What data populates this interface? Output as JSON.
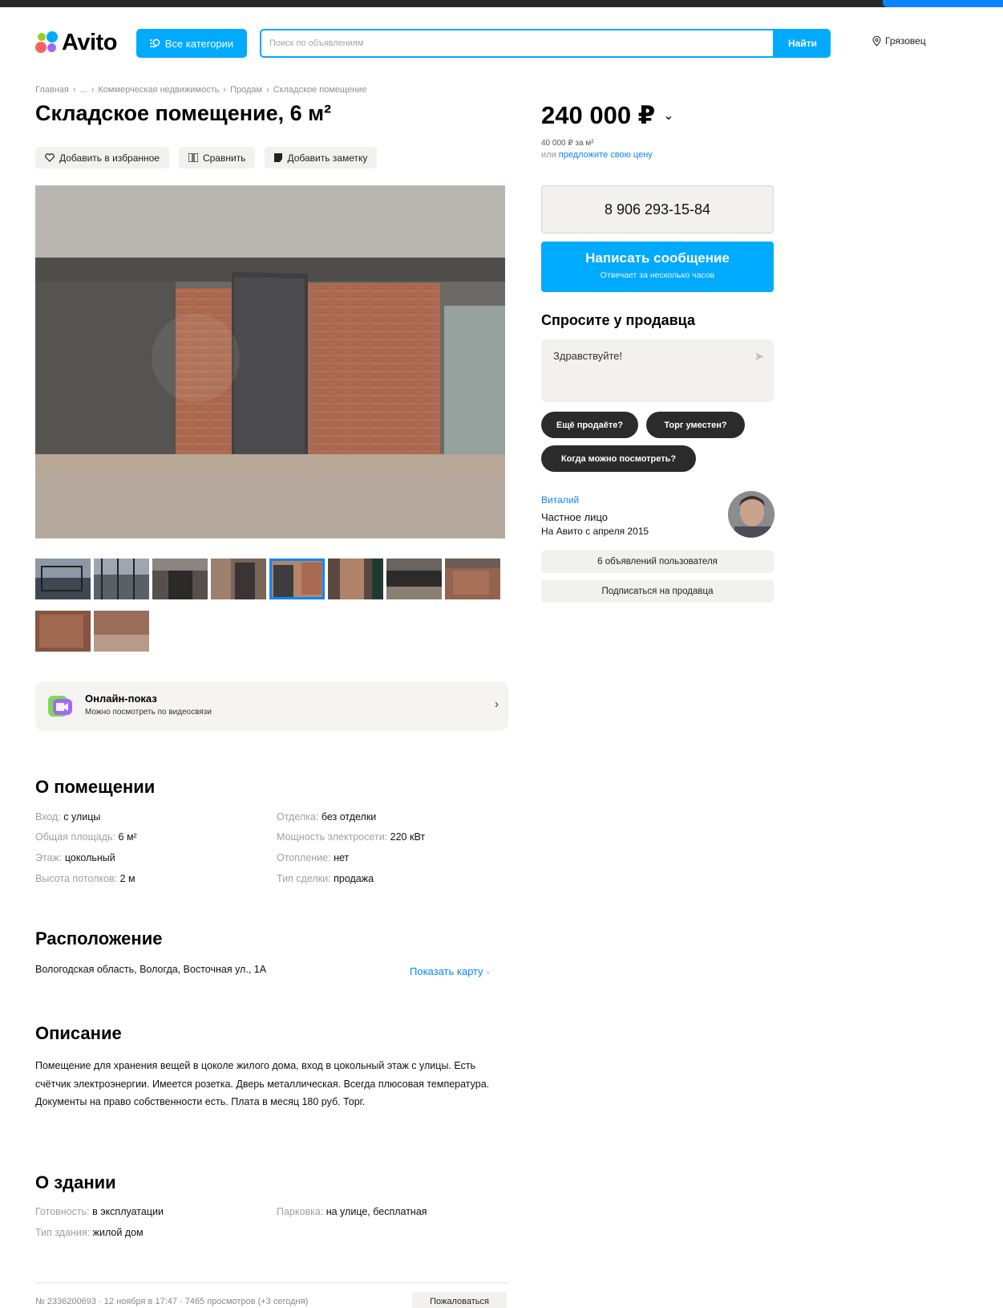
{
  "header": {
    "logo_text": "Avito",
    "categories_label": "Все категории",
    "search_placeholder": "Поиск по объявлениям",
    "search_button": "Найти",
    "location": "Грязовец"
  },
  "breadcrumb": [
    "Главная",
    "...",
    "Коммерческая недвижимость",
    "Продам",
    "Складское помещение"
  ],
  "title": "Складское помещение, 6 м²",
  "actions": {
    "favorite": "Добавить в избранное",
    "compare": "Сравнить",
    "note": "Добавить заметку"
  },
  "gallery": {
    "thumbnails_count": 10,
    "active_index": 4
  },
  "online_show": {
    "title": "Онлайн-показ",
    "subtitle": "Можно посмотреть по видеосвязи"
  },
  "about": {
    "heading": "О помещении",
    "left": [
      {
        "key": "Вход: ",
        "value": "с улицы"
      },
      {
        "key": "Общая площадь: ",
        "value": "6 м²"
      },
      {
        "key": "Этаж: ",
        "value": "цокольный"
      },
      {
        "key": "Высота потолков: ",
        "value": "2 м"
      }
    ],
    "right": [
      {
        "key": "Отделка: ",
        "value": "без отделки"
      },
      {
        "key": "Мощность электросети: ",
        "value": "220 кВт"
      },
      {
        "key": "Отопление: ",
        "value": "нет"
      },
      {
        "key": "Тип сделки: ",
        "value": "продажа"
      }
    ]
  },
  "location_section": {
    "heading": "Расположение",
    "address": "Вологодская область, Вологда, Восточная ул., 1А",
    "show_map": "Показать карту"
  },
  "description": {
    "heading": "Описание",
    "text": "Помещение для хранения вещей в цоколе жилого дома, вход в цокольный этаж с улицы. Есть счётчик электроэнергии. Имеется розетка. Дверь металлическая. Всегда плюсовая температура. Документы на право собственности есть. Плата в месяц 180 руб. Торг."
  },
  "building": {
    "heading": "О здании",
    "left": [
      {
        "key": "Готовность: ",
        "value": "в эксплуатации"
      },
      {
        "key": "Тип здания: ",
        "value": "жилой дом"
      }
    ],
    "right": [
      {
        "key": "Парковка: ",
        "value": "на улице, бесплатная"
      }
    ]
  },
  "footer": {
    "meta": "№ 2336200693 · 12 ноября в 17:47 · 7465 просмотров (+3 сегодня)",
    "report": "Пожаловаться"
  },
  "pricing": {
    "price": "240 000 ₽",
    "per_meter": "40 000 ₽ за м²",
    "offer_prefix": "или ",
    "offer_link": "предложите свою цену"
  },
  "contact": {
    "phone": "8 906 293-15-84",
    "message_title": "Написать сообщение",
    "message_sub": "Отвечает за несколько часов"
  },
  "ask": {
    "heading": "Спросите у продавца",
    "default_text": "Здравствуйте!",
    "chips": [
      "Ещё продаёте?",
      "Торг уместен?",
      "Когда можно посмотреть?"
    ]
  },
  "seller": {
    "name": "Виталий",
    "type": "Частное лицо",
    "since": "На Авито с апреля 2015",
    "listings_button": "6 объявлений пользователя",
    "subscribe_button": "Подписаться на продавца"
  },
  "colors": {
    "brand_blue": "#00aaff",
    "link_blue": "#0a84ff",
    "chip_dark": "#2b2b2b",
    "light_bg": "#f2f1f0"
  }
}
